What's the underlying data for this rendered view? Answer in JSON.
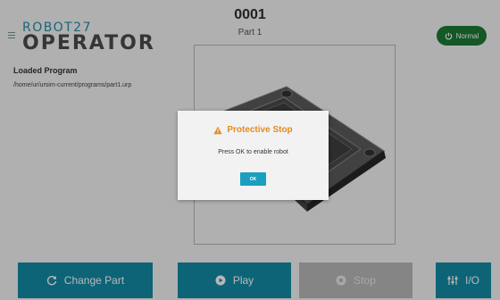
{
  "header": {
    "logo_line1": "ROBOT27",
    "logo_line2": "OPERATOR",
    "program_number": "0001",
    "part_name": "Part 1",
    "status_label": "Normal"
  },
  "program": {
    "title": "Loaded Program",
    "path": "/home/ur/ursim-current/programs/part1.urp"
  },
  "buttons": {
    "change_part": "Change Part",
    "play": "Play",
    "stop": "Stop",
    "io": "I/O"
  },
  "dialog": {
    "title": "Protective Stop",
    "message": "Press OK to enable robot",
    "ok_label": "OK"
  },
  "colors": {
    "accent": "#138ba6",
    "status_green": "#1b7a34",
    "warning": "#e58a1f",
    "disabled": "#b9b9b9"
  },
  "icons": {
    "menu": "hamburger-icon",
    "status": "power-icon",
    "change_part": "refresh-icon",
    "play": "play-circle-icon",
    "stop": "stop-circle-icon",
    "io": "sliders-icon",
    "dialog": "warning-icon"
  }
}
